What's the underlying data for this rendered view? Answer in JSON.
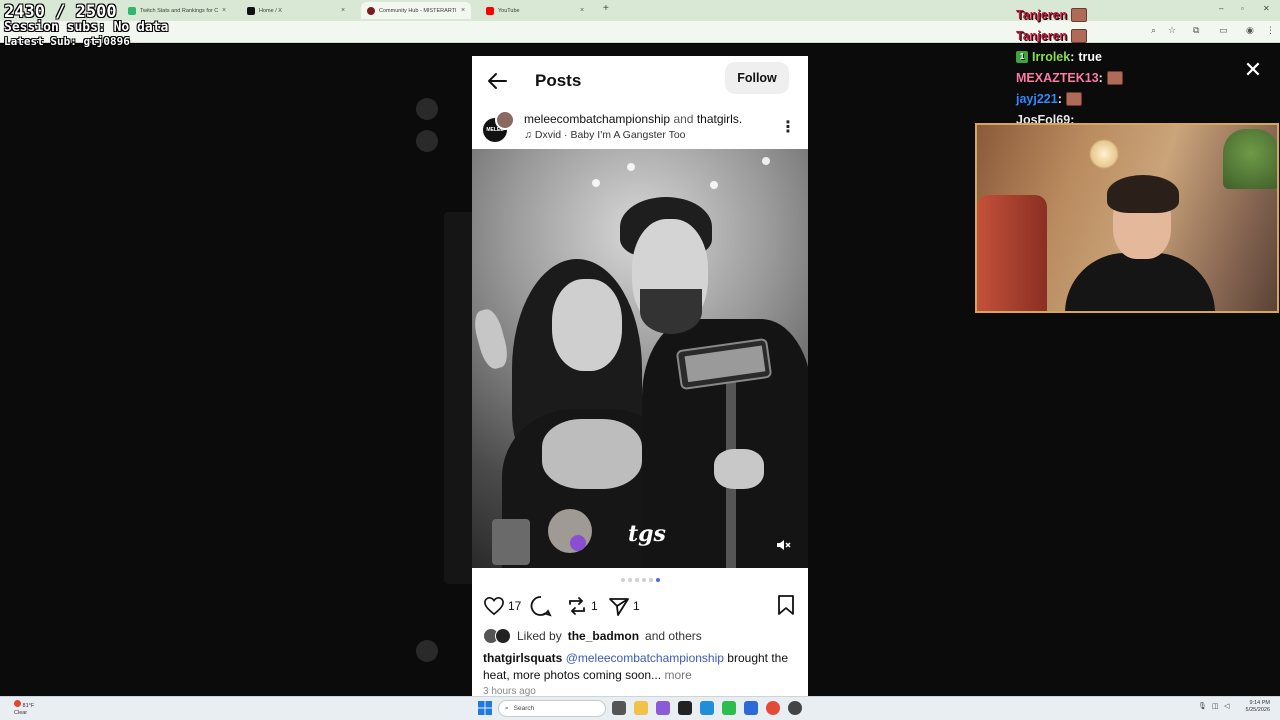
{
  "browser": {
    "tabs": [
      {
        "title": "Twitch Stats and Rankings for C...",
        "favicon_color": "#2fb86c",
        "active": false
      },
      {
        "title": "Home / X",
        "favicon_color": "#111111",
        "active": false
      },
      {
        "title": "Community Hub - MISTERARTI...",
        "favicon_color": "#7a1f1f",
        "active": true
      },
      {
        "title": "YouTube",
        "favicon_color": "#ff0000",
        "active": false
      }
    ],
    "tab_close": "×",
    "new_tab": "+"
  },
  "stream_overlay": {
    "sub_goal": "2430 / 2500",
    "session_subs": "Session subs: No data",
    "latest_sub": "Latest Sub: gtj0896",
    "chat": [
      {
        "user": "Tanjeren",
        "color": "#c2183b",
        "message": "",
        "emote": true
      },
      {
        "user": "Tanjeren",
        "color": "#c2183b",
        "message": "",
        "emote": true
      },
      {
        "user": "Irrolek",
        "color": "#8be04a",
        "message": "true",
        "badge": "1"
      },
      {
        "user": "MEXAZTEK13",
        "color": "#ff7aa8",
        "message": "",
        "emote": true
      },
      {
        "user": "jayj221",
        "color": "#2d8cff",
        "message": "",
        "emote": true
      },
      {
        "user": "JosFol69",
        "color": "#e9e9e9",
        "message": ""
      }
    ]
  },
  "post": {
    "header_title": "Posts",
    "follow_label": "Follow",
    "author_primary": "meleecombatchampionship",
    "author_and": "and",
    "author_secondary": "thatgirls.",
    "author_avatar_text": "MELEE",
    "audio_track": "Dxvid · Baby I'm A Gangster Too",
    "photo_logo": "tgs",
    "carousel": {
      "total": 6,
      "active_index": 5
    },
    "actions": {
      "likes": "17",
      "comments": "",
      "reposts": "1",
      "shares": "1"
    },
    "liked_by_prefix": "Liked by",
    "liked_by_user": "the_badmon",
    "liked_by_suffix": "and others",
    "caption_user": "thatgirlsquats",
    "caption_mention": "@meleecombatchampionship",
    "caption_text": "brought the heat, more photos coming soon...",
    "caption_more": "more",
    "time_ago": "3 hours ago"
  },
  "taskbar": {
    "weather_temp": "81°F",
    "weather_cond": "Clear",
    "search_placeholder": "Search",
    "clock_time": "9:14 PM",
    "clock_date": "5/25/2026"
  },
  "colors": {
    "tab_bar": "#d9e8d4",
    "mention": "#3b5bb5",
    "webcam_border": "#d6a65a"
  }
}
